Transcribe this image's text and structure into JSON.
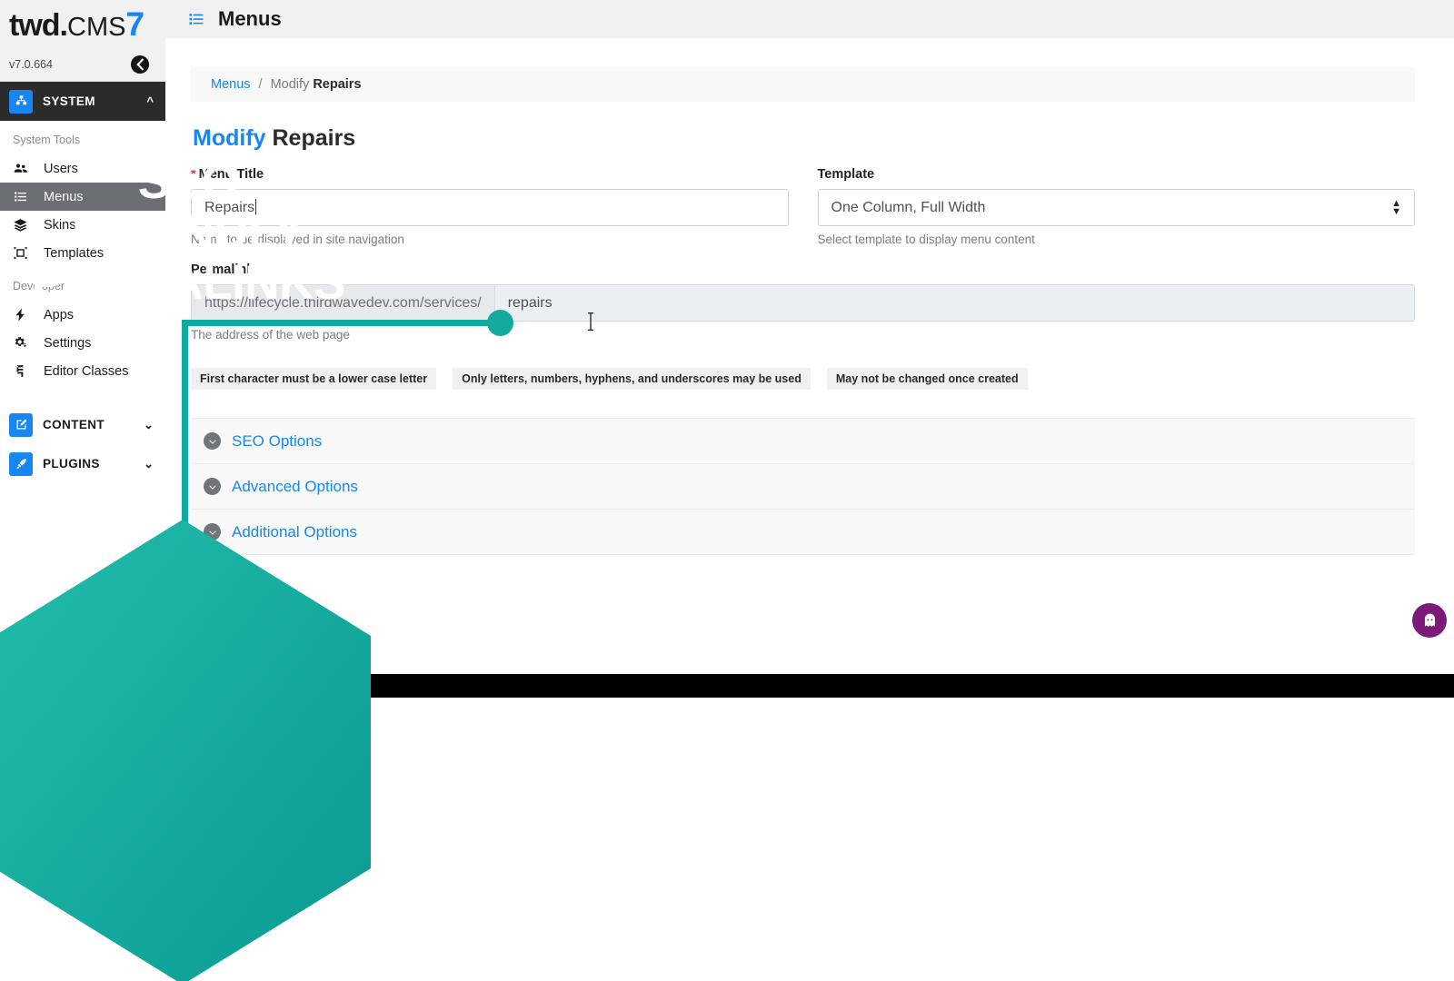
{
  "brand": {
    "name_part1": "twd",
    "name_dot": ".",
    "name_part2": "CMS",
    "name_version_mark": "7",
    "version": "v7.0.664",
    "collapse_icon": "chevron-left-icon"
  },
  "sidebar": {
    "groups": [
      {
        "label": "SYSTEM",
        "icon": "sitemap-icon",
        "caret": "^",
        "expanded": true,
        "sections": [
          {
            "label": "System Tools",
            "items": [
              {
                "label": "Users",
                "icon": "users-icon",
                "active": false
              },
              {
                "label": "Menus",
                "icon": "list-icon",
                "active": true
              },
              {
                "label": "Skins",
                "icon": "layers-icon",
                "active": false
              },
              {
                "label": "Templates",
                "icon": "template-icon",
                "active": false
              }
            ]
          },
          {
            "label": "Developer",
            "items": [
              {
                "label": "Apps",
                "icon": "bolt-icon",
                "active": false
              },
              {
                "label": "Settings",
                "icon": "gears-icon",
                "active": false
              },
              {
                "label": "Editor Classes",
                "icon": "css-icon",
                "active": false
              }
            ]
          }
        ]
      },
      {
        "label": "CONTENT",
        "icon": "edit-square-icon",
        "caret": "⌄",
        "expanded": false,
        "sections": []
      },
      {
        "label": "PLUGINS",
        "icon": "rocket-icon",
        "caret": "⌄",
        "expanded": false,
        "sections": []
      }
    ]
  },
  "topbar": {
    "icon": "list-icon",
    "title": "Menus"
  },
  "breadcrumb": {
    "root": "Menus",
    "separator": "/",
    "current_prefix": "Modify ",
    "current_name": "Repairs"
  },
  "page": {
    "title_prefix": "Modify",
    "title_name": "Repairs"
  },
  "form": {
    "menu_title": {
      "label": "Menu Title",
      "required_marker": "*",
      "value": "Repairs",
      "placeholder": "Menu Title",
      "hint": "Name to be displayed in site navigation"
    },
    "template": {
      "label": "Template",
      "value": "One Column, Full Width",
      "hint": "Select template to display menu content",
      "options": [
        "One Column, Full Width"
      ]
    },
    "permalink": {
      "label": "Permalink",
      "prefix": "https://lifecycle.thirdwavedev.com/services/",
      "value": "repairs",
      "placeholder": "permalink",
      "hint": "The address of the web page",
      "rules": [
        "First character must be a lower case letter",
        "Only letters, numbers, hyphens, and underscores may be used",
        "May not be changed once created"
      ]
    }
  },
  "accordion": [
    {
      "label": "SEO Options",
      "icon": "chevron-down-circle-icon"
    },
    {
      "label": "Advanced Options",
      "icon": "chevron-down-circle-icon"
    },
    {
      "label": "Additional Options",
      "icon": "chevron-down-circle-icon"
    }
  ],
  "callout": {
    "line1": "SEO",
    "line2": "FRIENDLY",
    "line3": "PERMALINKS",
    "color_start": "#1fb9a8",
    "color_end": "#0c9f95",
    "highlight_color": "#0fab9e"
  },
  "floating_button": {
    "icon": "ghost-icon",
    "color": "#7b1a7b"
  },
  "colors": {
    "accent_blue": "#1886f2",
    "sidebar_active": "#6b6f74",
    "header_bg": "#f0f0f0",
    "required_red": "#d9364b"
  }
}
